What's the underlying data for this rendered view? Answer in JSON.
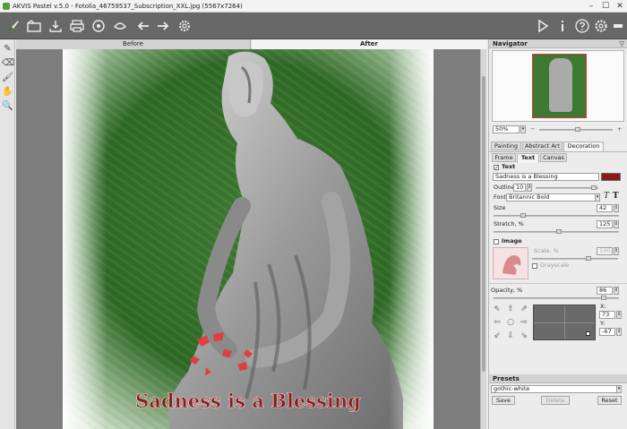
{
  "window": {
    "title": "AKVIS Pastel v.5.0 - Fotolia_46759537_Subscription_XXL.jpg (5567x7264)",
    "minimize": "–",
    "maximize": "☐",
    "close": "✕"
  },
  "toolbar": {
    "left_icons": [
      "brush-logo-icon",
      "open-file-icon",
      "save-icon",
      "print-icon",
      "share-icon",
      "batch-icon",
      "undo-icon",
      "redo-icon",
      "settings-gear-icon"
    ],
    "right_icons": [
      "run-play-icon",
      "info-icon",
      "help-icon",
      "preferences-icon",
      "menu-icon"
    ]
  },
  "view_tabs": {
    "before": "Before",
    "after": "After"
  },
  "image": {
    "overlay_text": "Sadness is a Blessing",
    "text_color": "#8b1a1a"
  },
  "navigator": {
    "header": "Navigator",
    "zoom": "50%",
    "zoom_out": "−",
    "zoom_in": "+"
  },
  "panel_tabs": {
    "painting": "Painting",
    "abstract_art": "Abstract Art",
    "decoration": "Decoration"
  },
  "decoration_tabs": {
    "frame": "Frame",
    "text": "Text",
    "canvas": "Canvas"
  },
  "text_section": {
    "label": "Text",
    "checked": true,
    "value": "Sadness is a Blessing",
    "color": "#8b1a1a",
    "outline_label": "Outline",
    "outline_value": "10",
    "font_label": "Font",
    "font_value": "Britannic Bold",
    "bold_glyph": "T",
    "italic_glyph": "T",
    "size_label": "Size",
    "size_value": "42",
    "stretch_label": "Stretch, %",
    "stretch_value": "125"
  },
  "image_section": {
    "label": "Image",
    "checked": false,
    "scale_label": "Scale, %",
    "scale_value": "100",
    "grayscale_label": "Grayscale"
  },
  "opacity": {
    "label": "Opacity, %",
    "value": "86"
  },
  "position": {
    "x_label": "X:",
    "x_value": "73",
    "y_label": "Y:",
    "y_value": "-67"
  },
  "presets": {
    "header": "Presets",
    "selected": "gothic-white",
    "save": "Save",
    "delete": "Delete",
    "reset": "Reset"
  }
}
